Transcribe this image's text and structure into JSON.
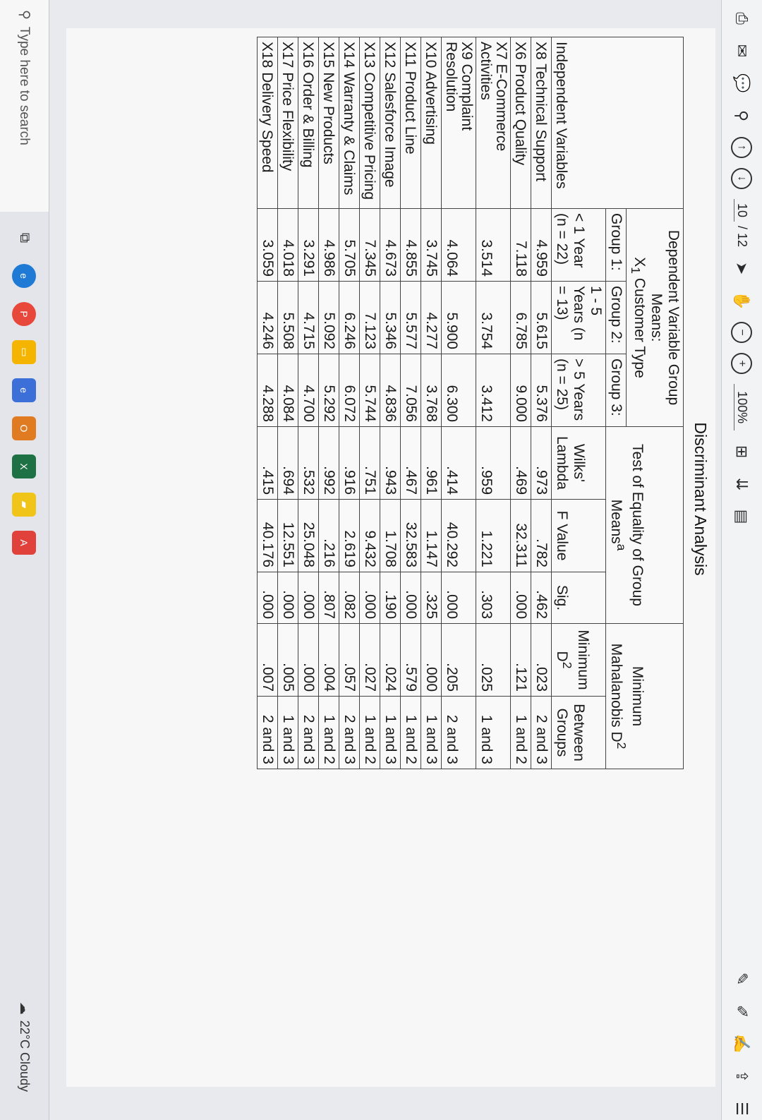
{
  "toolbar": {
    "page_current": "10",
    "page_total": "/ 12",
    "zoom": "100%"
  },
  "document": {
    "title": "Discriminant Analysis",
    "headers": {
      "independent_vars": "Independent Variables",
      "dep_means": "Dependent Variable Group Means:",
      "dep_means_sub": "X",
      "dep_means_sub_idx": "1",
      "dep_means_sub_rest": " Customer Type",
      "equality": "Test of Equality of Group Means",
      "equality_sup": "a",
      "mahalanobis": "Minimum Mahalanobis D",
      "mahalanobis_sup": "2",
      "group1": "Group 1:",
      "group2": "Group 2:",
      "group3": "Group 3:",
      "group1_sub": "< 1 Year (n = 22)",
      "group2_sub": "1 - 5 Years (n = 13)",
      "group3_sub": "> 5 Years (n = 25)",
      "wilks": "Wilks' Lambda",
      "f_value": "F Value",
      "sig": "Sig.",
      "min_d2": "Minimum D",
      "min_d2_sup": "2",
      "between": "Between Groups"
    },
    "rows": [
      {
        "var": "X8 Technical Support",
        "g1": "4.959",
        "g2": "5.615",
        "g3": "5.376",
        "wilks": ".973",
        "f": ".782",
        "sig": ".462",
        "d2": ".023",
        "between": "2 and 3"
      },
      {
        "var": "X6 Product Quality",
        "g1": "7.118",
        "g2": "6.785",
        "g3": "9.000",
        "wilks": ".469",
        "f": "32.311",
        "sig": ".000",
        "d2": ".121",
        "between": "1 and 2"
      },
      {
        "var": "X7 E-Commerce Activities",
        "g1": "3.514",
        "g2": "3.754",
        "g3": "3.412",
        "wilks": ".959",
        "f": "1.221",
        "sig": ".303",
        "d2": ".025",
        "between": "1 and 3"
      },
      {
        "var": "X9 Complaint Resolution",
        "g1": "4.064",
        "g2": "5.900",
        "g3": "6.300",
        "wilks": ".414",
        "f": "40.292",
        "sig": ".000",
        "d2": ".205",
        "between": "2 and 3"
      },
      {
        "var": "X10 Advertising",
        "g1": "3.745",
        "g2": "4.277",
        "g3": "3.768",
        "wilks": ".961",
        "f": "1.147",
        "sig": ".325",
        "d2": ".000",
        "between": "1 and 3"
      },
      {
        "var": "X11 Product Line",
        "g1": "4.855",
        "g2": "5.577",
        "g3": "7.056",
        "wilks": ".467",
        "f": "32.583",
        "sig": ".000",
        "d2": ".579",
        "between": "1 and 2"
      },
      {
        "var": "X12 Salesforce Image",
        "g1": "4.673",
        "g2": "5.346",
        "g3": "4.836",
        "wilks": ".943",
        "f": "1.708",
        "sig": ".190",
        "d2": ".024",
        "between": "1 and 3"
      },
      {
        "var": "X13 Competitive Pricing",
        "g1": "7.345",
        "g2": "7.123",
        "g3": "5.744",
        "wilks": ".751",
        "f": "9.432",
        "sig": ".000",
        "d2": ".027",
        "between": "1 and 2"
      },
      {
        "var": "X14 Warranty & Claims",
        "g1": "5.705",
        "g2": "6.246",
        "g3": "6.072",
        "wilks": ".916",
        "f": "2.619",
        "sig": ".082",
        "d2": ".057",
        "between": "2 and 3"
      },
      {
        "var": "X15 New Products",
        "g1": "4.986",
        "g2": "5.092",
        "g3": "5.292",
        "wilks": ".992",
        "f": ".216",
        "sig": ".807",
        "d2": ".004",
        "between": "1 and 2"
      },
      {
        "var": "X16 Order & Billing",
        "g1": "3.291",
        "g2": "4.715",
        "g3": "4.700",
        "wilks": ".532",
        "f": "25.048",
        "sig": ".000",
        "d2": ".000",
        "between": "2 and 3"
      },
      {
        "var": "X17 Price Flexibility",
        "g1": "4.018",
        "g2": "5.508",
        "g3": "4.084",
        "wilks": ".694",
        "f": "12.551",
        "sig": ".000",
        "d2": ".005",
        "between": "1 and 3"
      },
      {
        "var": "X18 Delivery Speed",
        "g1": "3.059",
        "g2": "4.246",
        "g3": "4.288",
        "wilks": ".415",
        "f": "40.176",
        "sig": ".000",
        "d2": ".007",
        "between": "2 and 3"
      }
    ]
  },
  "taskbar": {
    "search_placeholder": "Type here to search",
    "weather": "22°C  Cloudy"
  },
  "colors": {
    "page": "#f7f7f8",
    "toolbar": "#f2f3f5",
    "taskbar": "#e3e5ea"
  }
}
